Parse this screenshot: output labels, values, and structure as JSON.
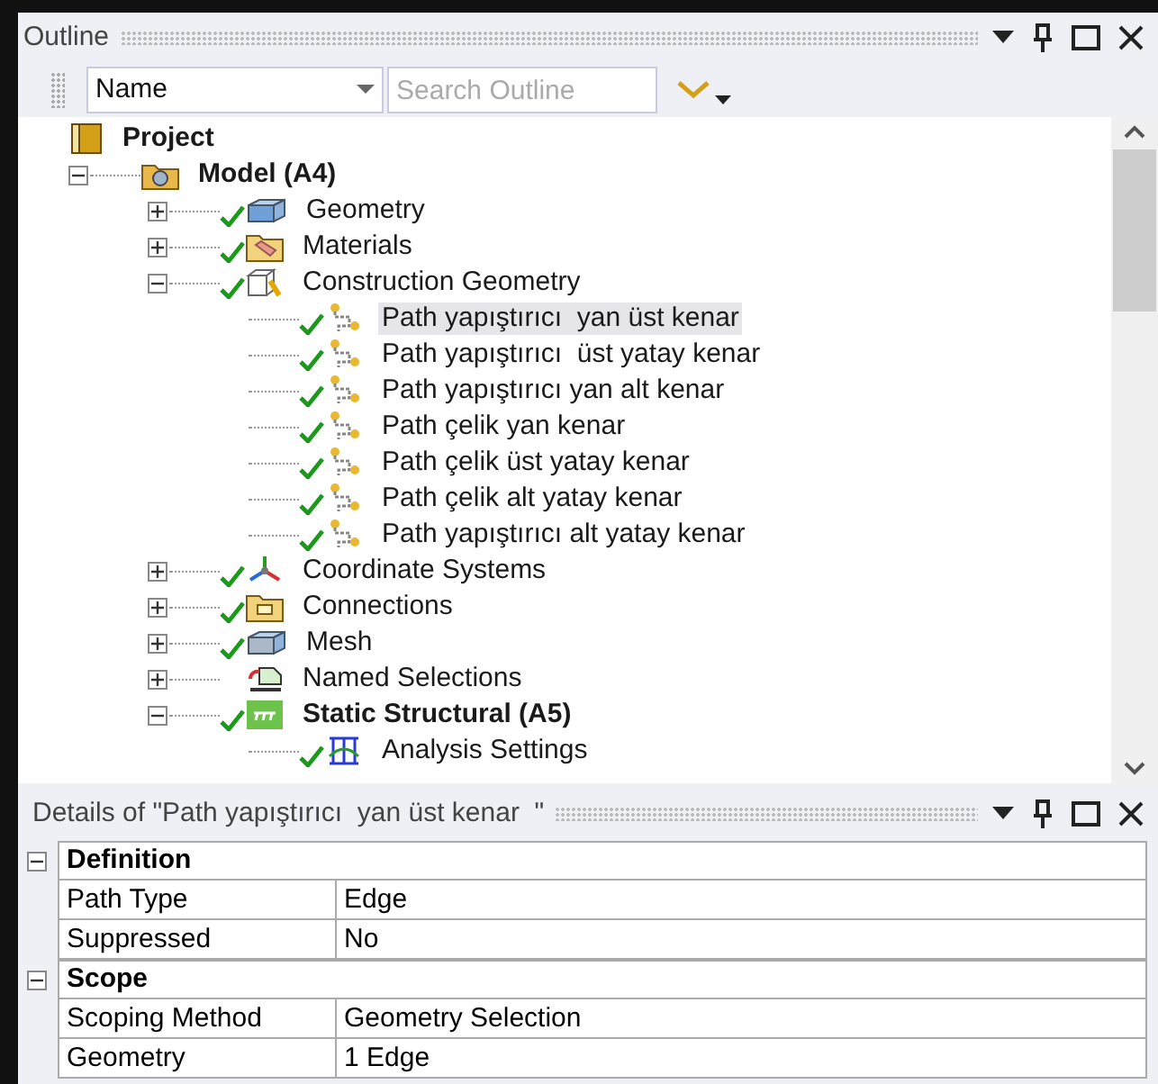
{
  "outline": {
    "title": "Outline",
    "toolbar": {
      "sort_field": {
        "value": "Name"
      },
      "search": {
        "placeholder": "Search Outline"
      }
    },
    "tree": [
      {
        "label": "Project",
        "kind": "project",
        "children": [
          {
            "label": "Model (A4)",
            "kind": "model",
            "expanded": true,
            "children": [
              {
                "label": "Geometry",
                "kind": "geometry",
                "expanded": false,
                "checked": true
              },
              {
                "label": "Materials",
                "kind": "materials",
                "expanded": false,
                "checked": true
              },
              {
                "label": "Construction Geometry",
                "kind": "construction",
                "expanded": true,
                "checked": true,
                "children": [
                  {
                    "label": "Path yapıştırıcı  yan üst kenar",
                    "kind": "path",
                    "checked": true,
                    "selected": true
                  },
                  {
                    "label": "Path yapıştırıcı  üst yatay kenar",
                    "kind": "path",
                    "checked": true,
                    "selected": false
                  },
                  {
                    "label": "Path yapıştırıcı yan alt kenar",
                    "kind": "path",
                    "checked": true,
                    "selected": false
                  },
                  {
                    "label": "Path çelik yan kenar",
                    "kind": "path",
                    "checked": true,
                    "selected": false
                  },
                  {
                    "label": "Path çelik üst yatay kenar",
                    "kind": "path",
                    "checked": true,
                    "selected": false
                  },
                  {
                    "label": "Path çelik alt yatay kenar",
                    "kind": "path",
                    "checked": true,
                    "selected": false
                  },
                  {
                    "label": "Path yapıştırıcı alt yatay kenar",
                    "kind": "path",
                    "checked": true,
                    "selected": false
                  }
                ]
              },
              {
                "label": "Coordinate Systems",
                "kind": "coordinates",
                "expanded": false,
                "checked": true
              },
              {
                "label": "Connections",
                "kind": "connections",
                "expanded": false,
                "checked": true
              },
              {
                "label": "Mesh",
                "kind": "mesh",
                "expanded": false,
                "checked": true
              },
              {
                "label": "Named Selections",
                "kind": "named",
                "expanded": false,
                "checked": false
              },
              {
                "label": "Static Structural (A5)",
                "kind": "analysis",
                "expanded": true,
                "checked": true,
                "children": [
                  {
                    "label": "Analysis Settings",
                    "kind": "settings",
                    "checked": true
                  }
                ]
              }
            ]
          }
        ]
      }
    ]
  },
  "details": {
    "title": "Details of \"Path yapıştırıcı  yan üst kenar  \"",
    "groups": [
      {
        "label": "Definition",
        "expanded": true,
        "rows": [
          {
            "property": "Path Type",
            "value": "Edge"
          },
          {
            "property": "Suppressed",
            "value": "No"
          }
        ]
      },
      {
        "label": "Scope",
        "expanded": true,
        "rows": [
          {
            "property": "Scoping Method",
            "value": "Geometry Selection"
          },
          {
            "property": "Geometry",
            "value": "1 Edge"
          }
        ]
      }
    ]
  }
}
